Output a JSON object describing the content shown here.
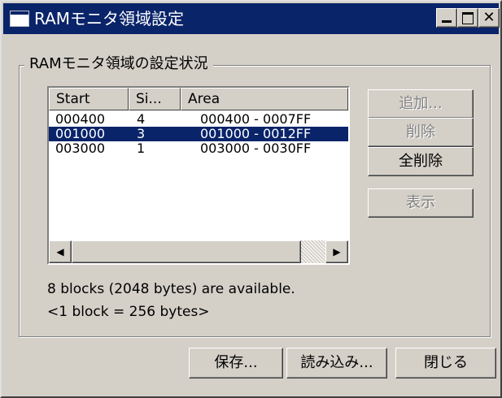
{
  "window": {
    "title": "RAMモニタ領域設定",
    "caption_buttons": [
      "minimize-icon",
      "maximize-icon",
      "close-icon"
    ],
    "close_glyph": "✕"
  },
  "group": {
    "title": "RAMモニタ領域の設定状況"
  },
  "list": {
    "columns": [
      "Start",
      "Si...",
      "Area"
    ],
    "rows": [
      {
        "start": "000400",
        "size": "4",
        "area": "000400 - 0007FF",
        "selected": false
      },
      {
        "start": "001000",
        "size": "3",
        "area": "001000 - 0012FF",
        "selected": true
      },
      {
        "start": "003000",
        "size": "1",
        "area": "003000 - 0030FF",
        "selected": false
      }
    ]
  },
  "side_buttons": {
    "add": "追加...",
    "delete": "削除",
    "delete_all": "全削除",
    "show": "表示"
  },
  "info": {
    "available": "8 blocks (2048 bytes) are available.",
    "block_size": "<1 block = 256 bytes>"
  },
  "bottom_buttons": {
    "save": "保存...",
    "load": "読み込み...",
    "close": "閉じる"
  },
  "colors": {
    "face": "#d4d0c8",
    "title_bar": "#0a246a",
    "selection": "#0a246a",
    "disabled_text": "#808080"
  }
}
